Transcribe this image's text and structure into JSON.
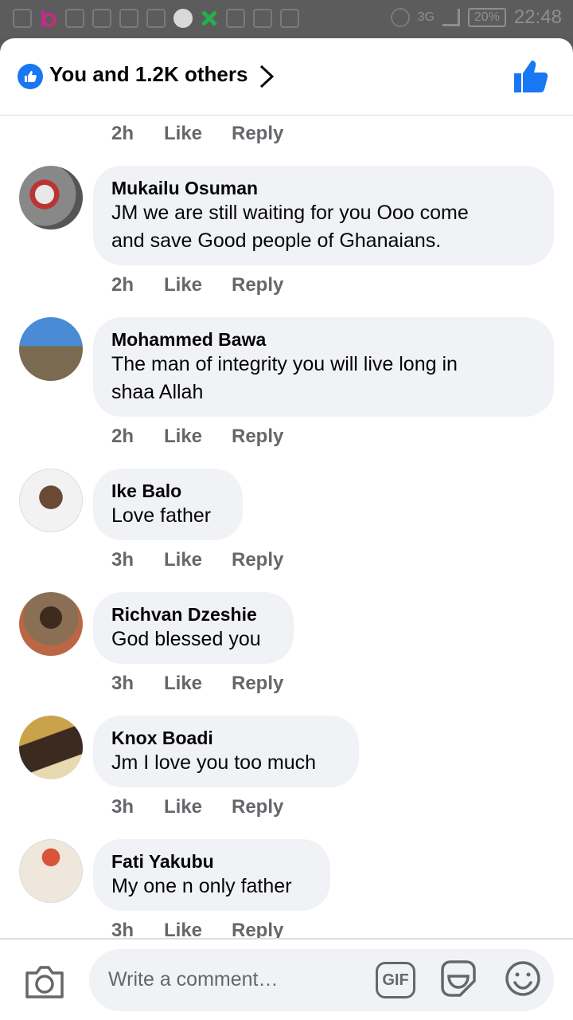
{
  "status_bar": {
    "battery": "20%",
    "time": "22:48",
    "network": "3G"
  },
  "header": {
    "title": "You and 1.2K others"
  },
  "first_meta": {
    "time": "2h",
    "like": "Like",
    "reply": "Reply"
  },
  "comments": [
    {
      "name": "Mukailu Osuman",
      "lines": [
        "JM we are still waiting for you Ooo come",
        "and save Good people of Ghanaians."
      ],
      "time": "2h",
      "like": "Like",
      "reply": "Reply"
    },
    {
      "name": "Mohammed Bawa",
      "lines": [
        "The man of integrity you will live long in",
        "shaa Allah"
      ],
      "time": "2h",
      "like": "Like",
      "reply": "Reply"
    },
    {
      "name": "Ike Balo",
      "lines": [
        "Love father"
      ],
      "time": "3h",
      "like": "Like",
      "reply": "Reply"
    },
    {
      "name": "Richvan Dzeshie",
      "lines": [
        "God blessed you"
      ],
      "time": "3h",
      "like": "Like",
      "reply": "Reply"
    },
    {
      "name": "Knox Boadi",
      "lines": [
        "Jm I love you too much"
      ],
      "time": "3h",
      "like": "Like",
      "reply": "Reply"
    },
    {
      "name": "Fati Yakubu",
      "lines": [
        "My one n only father"
      ],
      "time": "3h",
      "like": "Like",
      "reply": "Reply"
    }
  ],
  "composer": {
    "placeholder": "Write a comment…",
    "gif_label": "GIF"
  },
  "colors": {
    "accent": "#1877f2",
    "bubble": "#f0f2f5",
    "meta": "#65676b"
  }
}
